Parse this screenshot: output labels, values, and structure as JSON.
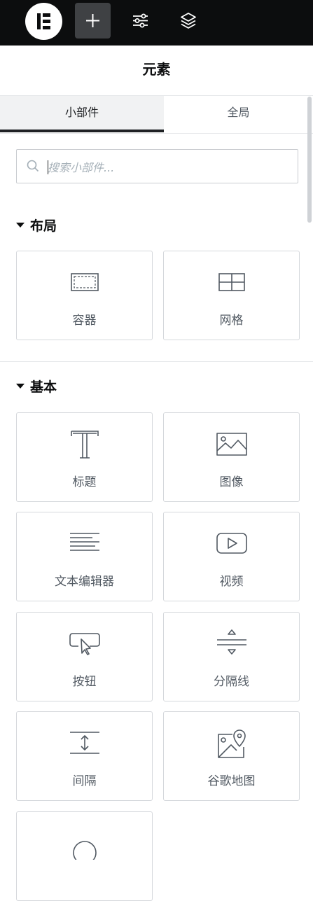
{
  "topbar": {
    "logo": "elementor-logo",
    "buttons": [
      {
        "icon": "plus-icon",
        "active": true
      },
      {
        "icon": "sliders-icon",
        "active": false
      },
      {
        "icon": "layers-icon",
        "active": false
      }
    ]
  },
  "panel": {
    "title": "元素"
  },
  "tabs": [
    {
      "label": "小部件",
      "active": true
    },
    {
      "label": "全局",
      "active": false
    }
  ],
  "search": {
    "placeholder": "搜索小部件...",
    "value": ""
  },
  "sections": [
    {
      "title": "布局",
      "widgets": [
        {
          "label": "容器",
          "icon": "container-icon"
        },
        {
          "label": "网格",
          "icon": "grid-icon"
        }
      ]
    },
    {
      "title": "基本",
      "widgets": [
        {
          "label": "标题",
          "icon": "heading-icon"
        },
        {
          "label": "图像",
          "icon": "image-icon"
        },
        {
          "label": "文本编辑器",
          "icon": "text-editor-icon"
        },
        {
          "label": "视频",
          "icon": "video-icon"
        },
        {
          "label": "按钮",
          "icon": "button-icon"
        },
        {
          "label": "分隔线",
          "icon": "divider-icon"
        },
        {
          "label": "间隔",
          "icon": "spacer-icon"
        },
        {
          "label": "谷歌地图",
          "icon": "google-maps-icon"
        },
        {
          "label": "",
          "icon": "star-icon"
        }
      ]
    }
  ],
  "colors": {
    "topbar": "#0c0d0e",
    "active_button": "#3f4144",
    "card_border": "#d5d8dc",
    "icon_stroke": "#515962"
  }
}
